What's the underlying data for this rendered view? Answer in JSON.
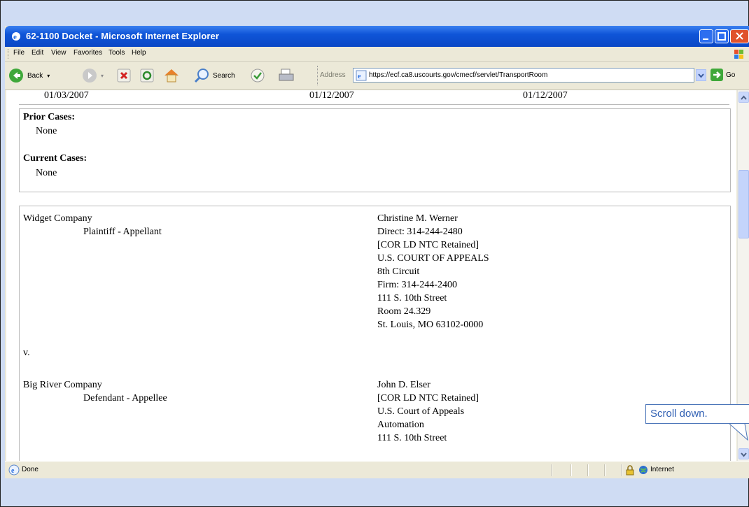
{
  "window": {
    "title": "62-1100 Docket - Microsoft Internet Explorer"
  },
  "menu": [
    "File",
    "Edit",
    "View",
    "Favorites",
    "Tools",
    "Help"
  ],
  "toolbar": {
    "back_label": "Back",
    "search_label": "Search"
  },
  "address": {
    "label": "Address",
    "url": "https://ecf.ca8.uscourts.gov/cmecf/servlet/TransportRoom",
    "go_label": "Go"
  },
  "dates": [
    "01/03/2007",
    "01/12/2007",
    "01/12/2007"
  ],
  "cases": {
    "prior_heading": "Prior Cases:",
    "prior_value": "None",
    "current_heading": "Current Cases:",
    "current_value": "None"
  },
  "parties": {
    "p1_name": "Widget Company",
    "p1_role": "Plaintiff - Appellant",
    "p1_counsel": [
      "Christine M. Werner",
      "Direct: 314-244-2480",
      "[COR LD NTC Retained]",
      "U.S. COURT OF APPEALS",
      "8th Circuit",
      "Firm: 314-244-2400",
      "111 S. 10th Street",
      "Room 24.329",
      "St. Louis, MO 63102-0000"
    ],
    "versus": "v.",
    "p2_name": "Big River Company",
    "p2_role": "Defendant - Appellee",
    "p2_counsel": [
      "John D. Elser",
      "[COR LD NTC Retained]",
      "U.S. Court of Appeals",
      "Automation",
      "111 S. 10th Street"
    ]
  },
  "status": {
    "text": "Done",
    "zone": "Internet"
  },
  "callout": {
    "text": "Scroll down."
  },
  "colors": {
    "titlebar": "#0a47c5",
    "callout_text": "#2f5fb3",
    "background": "#cfdcf3"
  }
}
